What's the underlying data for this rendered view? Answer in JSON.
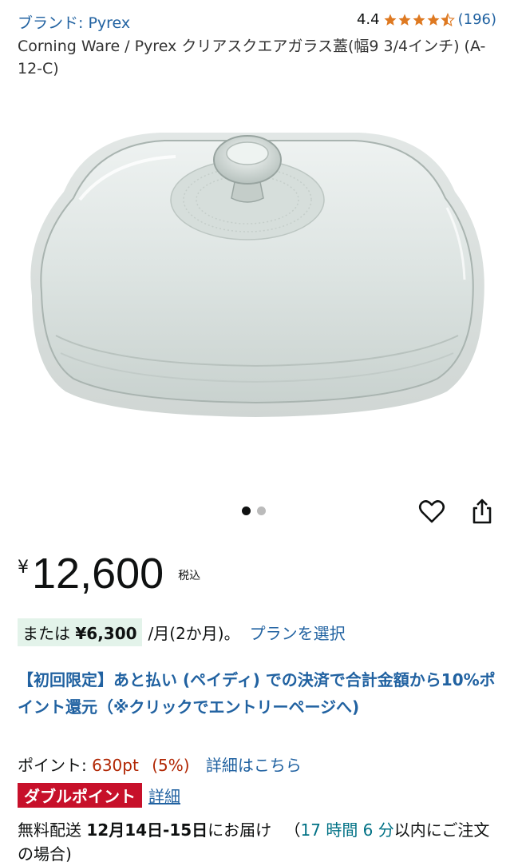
{
  "header": {
    "brand": "ブランド: Pyrex",
    "rating_value": "4.4",
    "rating_stars": 4.4,
    "review_count": "(196)"
  },
  "product": {
    "title": "Corning Ware / Pyrex クリアスクエアガラス蓋(幅9 3/4インチ) (A-12-C)"
  },
  "carousel": {
    "total": 2,
    "active": 1
  },
  "actions": {
    "favorite_icon": "heart-icon",
    "share_icon": "share-icon"
  },
  "price": {
    "symbol": "¥",
    "amount": "12,600",
    "tax": "税込"
  },
  "installment": {
    "prefix": "または",
    "amount": "¥6,300",
    "suffix": "/月(2か月)。",
    "link": "プランを選択"
  },
  "promo": {
    "text": "【初回限定】あと払い (ペイディ) での決済で合計金額から10%ポイント還元（※クリックでエントリーページへ)"
  },
  "points": {
    "label": "ポイント:",
    "value": "630pt",
    "percent": "(5%)",
    "link": "詳細はこちら"
  },
  "double_points": {
    "badge": "ダブルポイント",
    "link": "詳細"
  },
  "delivery": {
    "prefix": "無料配送",
    "dates": "12月14日-15日",
    "middle": "にお届け",
    "open_paren": "（",
    "countdown": "17 時間 6 分",
    "suffix": "以内にご注文の場合)"
  },
  "colors": {
    "link": "#2162a1",
    "price_red": "#b12704",
    "badge_red": "#c7102a",
    "star": "#de7921",
    "installment_bg": "#e3f3ea",
    "countdown": "#007185"
  }
}
